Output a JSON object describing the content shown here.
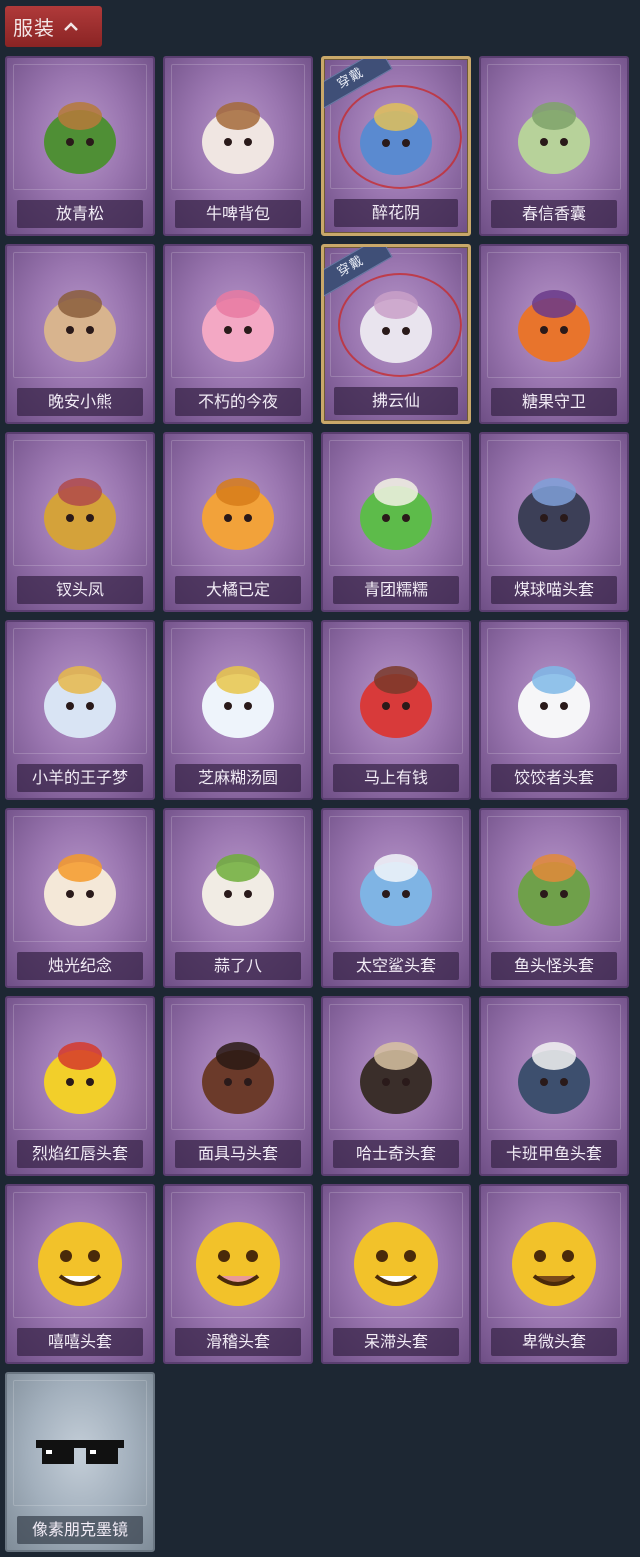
{
  "section": {
    "title": "服装"
  },
  "items": [
    {
      "label": "放青松",
      "icon": "bonsai-pine-icon",
      "equipped": false
    },
    {
      "label": "牛啤背包",
      "icon": "cow-beer-mug-icon",
      "equipped": false
    },
    {
      "label": "醉花阴",
      "icon": "flower-ornament-icon",
      "equipped": true,
      "badge": "穿戴"
    },
    {
      "label": "春信香囊",
      "icon": "sachet-icon",
      "equipped": false
    },
    {
      "label": "晚安小熊",
      "icon": "teddy-bear-icon",
      "equipped": false
    },
    {
      "label": "不朽的今夜",
      "icon": "pink-cat-cup-icon",
      "equipped": false
    },
    {
      "label": "拂云仙",
      "icon": "cloud-fairy-pendant-icon",
      "equipped": true,
      "badge": "穿戴"
    },
    {
      "label": "糖果守卫",
      "icon": "pumpkin-guard-icon",
      "equipped": false
    },
    {
      "label": "钗头凤",
      "icon": "phoenix-crown-doll-icon",
      "equipped": false
    },
    {
      "label": "大橘已定",
      "icon": "orange-slice-icon",
      "equipped": false
    },
    {
      "label": "青团糯糯",
      "icon": "green-rice-ball-icon",
      "equipped": false
    },
    {
      "label": "煤球喵头套",
      "icon": "black-cat-head-icon",
      "equipped": false
    },
    {
      "label": "小羊的王子梦",
      "icon": "sheep-crown-icon",
      "equipped": false
    },
    {
      "label": "芝麻糊汤圆",
      "icon": "rice-dumpling-icon",
      "equipped": false
    },
    {
      "label": "马上有钱",
      "icon": "red-horse-head-icon",
      "equipped": false
    },
    {
      "label": "饺饺者头套",
      "icon": "dumpling-head-icon",
      "equipped": false
    },
    {
      "label": "烛光纪念",
      "icon": "candle-head-icon",
      "equipped": false
    },
    {
      "label": "蒜了八",
      "icon": "garlic-head-icon",
      "equipped": false
    },
    {
      "label": "太空鲨头套",
      "icon": "shark-head-icon",
      "equipped": false
    },
    {
      "label": "鱼头怪头套",
      "icon": "fish-monster-head-icon",
      "equipped": false
    },
    {
      "label": "烈焰红唇头套",
      "icon": "yellow-mouse-head-icon",
      "equipped": false
    },
    {
      "label": "面具马头套",
      "icon": "horse-mask-icon",
      "equipped": false
    },
    {
      "label": "哈士奇头套",
      "icon": "husky-head-icon",
      "equipped": false
    },
    {
      "label": "卡班甲鱼头套",
      "icon": "turtle-head-icon",
      "equipped": false
    },
    {
      "label": "嘻嘻头套",
      "icon": "grin-emoji-head-icon",
      "equipped": false
    },
    {
      "label": "滑稽头套",
      "icon": "smirk-emoji-head-icon",
      "equipped": false
    },
    {
      "label": "呆滞头套",
      "icon": "stare-emoji-head-icon",
      "equipped": false
    },
    {
      "label": "卑微头套",
      "icon": "timid-emoji-head-icon",
      "equipped": false
    },
    {
      "label": "像素朋克墨镜",
      "icon": "pixel-sunglasses-icon",
      "equipped": false,
      "rarity": "common"
    }
  ]
}
